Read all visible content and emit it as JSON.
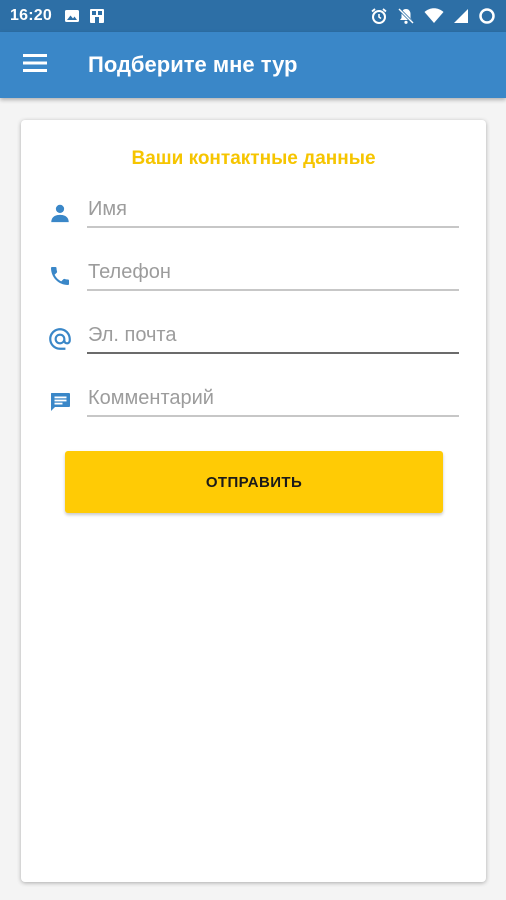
{
  "status_bar": {
    "time": "16:20",
    "left_icons": [
      "image-icon",
      "store-icon"
    ],
    "right_icons": [
      "alarm-icon",
      "notifications-off-icon",
      "wifi-icon",
      "signal-icon",
      "battery-icon"
    ]
  },
  "app_bar": {
    "title": "Подберите мне тур",
    "menu_icon": "menu-icon"
  },
  "form": {
    "title": "Ваши контактные данные",
    "fields": [
      {
        "icon": "person-icon",
        "placeholder": "Имя",
        "value": ""
      },
      {
        "icon": "phone-icon",
        "placeholder": "Телефон",
        "value": ""
      },
      {
        "icon": "at-icon",
        "placeholder": "Эл. почта",
        "value": ""
      },
      {
        "icon": "comment-icon",
        "placeholder": "Комментарий",
        "value": ""
      }
    ],
    "submit_label": "ОТПРАВИТЬ"
  },
  "colors": {
    "status_bar": "#2d6fa6",
    "app_bar": "#3a87c8",
    "accent_yellow": "#ffcb05",
    "title_yellow": "#f6c500",
    "icon_blue": "#3a87c8"
  }
}
